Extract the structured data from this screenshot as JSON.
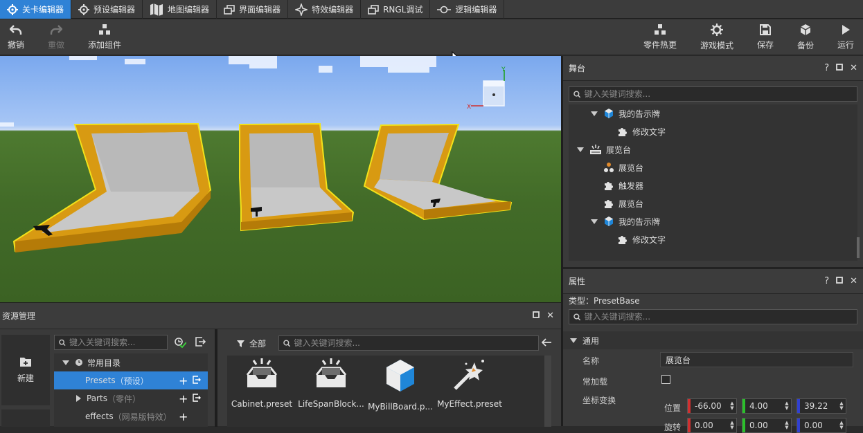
{
  "tabs": [
    {
      "label": "关卡编辑器",
      "active": true
    },
    {
      "label": "预设编辑器",
      "active": false
    },
    {
      "label": "地图编辑器",
      "active": false
    },
    {
      "label": "界面编辑器",
      "active": false
    },
    {
      "label": "特效编辑器",
      "active": false
    },
    {
      "label": "RNGL调试",
      "active": false
    },
    {
      "label": "逻辑编辑器",
      "active": false
    }
  ],
  "toolbar": {
    "undo": "撤销",
    "redo": "重做",
    "add_component": "添加组件",
    "hot_reload": "零件热更",
    "game_mode": "游戏模式",
    "save": "保存",
    "backup": "备份",
    "run": "运行"
  },
  "viewport": {
    "gizmo_axis_y": "Y",
    "gizmo_axis_x": "X"
  },
  "stage": {
    "title": "舞台",
    "search_placeholder": "键入关键词搜索...",
    "tree": [
      {
        "label": "我的告示牌",
        "indent": 1,
        "expand": "open",
        "icon": "cube-icon"
      },
      {
        "label": "修改文字",
        "indent": 2,
        "expand": "none",
        "icon": "puzzle-icon"
      },
      {
        "label": "展览台",
        "indent": 0,
        "expand": "open",
        "icon": "showcase-icon"
      },
      {
        "label": "展览台",
        "indent": 1,
        "expand": "none",
        "icon": "nodes-icon"
      },
      {
        "label": "触发器",
        "indent": 1,
        "expand": "none",
        "icon": "puzzle-icon"
      },
      {
        "label": "展览台",
        "indent": 1,
        "expand": "none",
        "icon": "puzzle-icon"
      },
      {
        "label": "我的告示牌",
        "indent": 1,
        "expand": "open",
        "icon": "cube-icon"
      },
      {
        "label": "修改文字",
        "indent": 2,
        "expand": "none",
        "icon": "puzzle-icon"
      }
    ]
  },
  "properties": {
    "title": "属性",
    "type_label": "类型：PresetBase",
    "search_placeholder": "键入关键词搜索...",
    "section": "通用",
    "name_label": "名称",
    "name_value": "展览台",
    "always_load_label": "常加载",
    "always_load_checked": false,
    "transform_label": "坐标变换",
    "position_label": "位置",
    "position": [
      "-66.00",
      "4.00",
      "39.22"
    ],
    "rotation_label": "旋转",
    "rotation": [
      "0.00",
      "0.00",
      "0.00"
    ],
    "axis_colors": [
      "#d03030",
      "#2bc02b",
      "#3040d0"
    ]
  },
  "assets": {
    "title": "资源管理",
    "new_button": "新建",
    "search_placeholder": "键入关键词搜索...",
    "filter_label": "全部",
    "right_search_placeholder": "键入关键词搜索...",
    "tree": [
      {
        "label": "常用目录",
        "sub": ""
      },
      {
        "label": "Presets",
        "sub": "（预设）"
      },
      {
        "label": "Parts",
        "sub": "（零件）"
      },
      {
        "label": "effects",
        "sub": "（网易版特效）"
      }
    ],
    "files": [
      {
        "label": "Cabinet.preset",
        "icon": "tray-icon"
      },
      {
        "label": "LifeSpanBlock...",
        "icon": "tray-icon"
      },
      {
        "label": "MyBillBoard.p...",
        "icon": "cube-icon"
      },
      {
        "label": "MyEffect.preset",
        "icon": "wand-icon"
      }
    ]
  },
  "colors": {
    "accent": "#2f82d6",
    "panel": "#3c3c3c",
    "background": "#2b2b2b",
    "frame_gold": "#d89a12",
    "frame_highlight": "#f2e21a"
  }
}
